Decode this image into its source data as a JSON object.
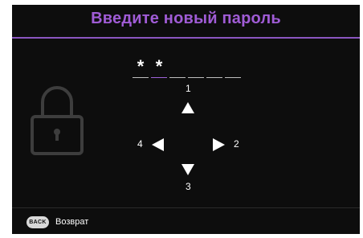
{
  "osd": {
    "title": "Введите новый пароль",
    "password": {
      "slots": [
        "*",
        "*",
        "",
        "",
        "",
        ""
      ],
      "active_index": 1
    },
    "arrows": {
      "up": "1",
      "right": "2",
      "down": "3",
      "left": "4"
    },
    "footer": {
      "back_button": "BACK",
      "back_label": "Возврат"
    },
    "icons": {
      "lock": "lock-icon",
      "up": "arrow-up-icon",
      "down": "arrow-down-icon",
      "left": "arrow-left-icon",
      "right": "arrow-right-icon"
    },
    "colors": {
      "background": "#0d0d0d",
      "accent": "#a05cd6",
      "text": "#ffffff",
      "icon_muted": "#3d3d3d"
    }
  }
}
